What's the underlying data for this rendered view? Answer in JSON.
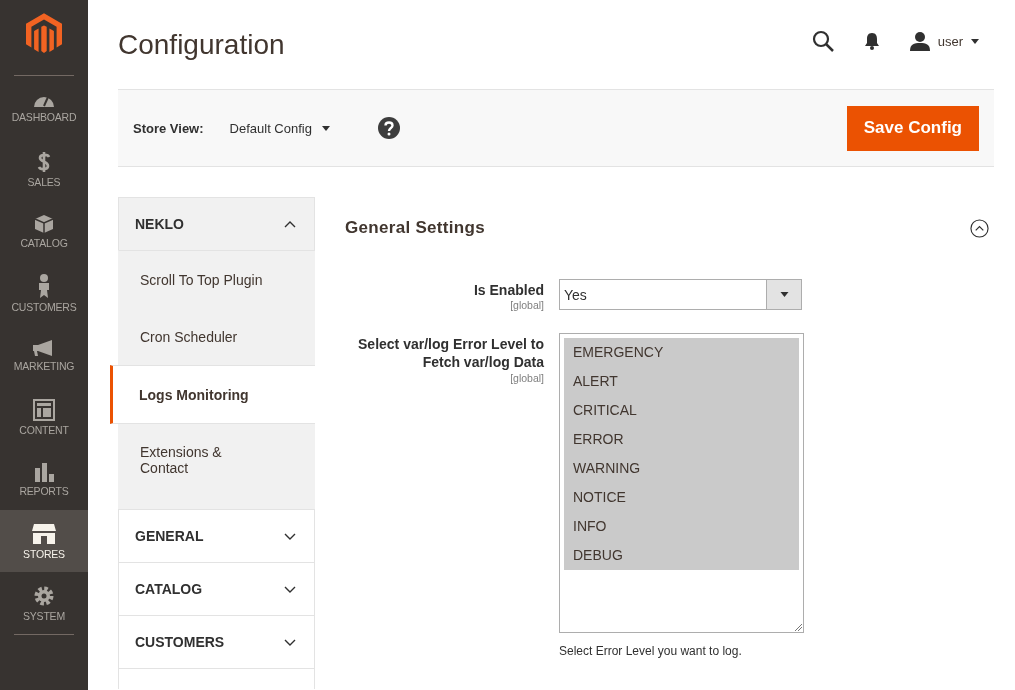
{
  "sidebar": {
    "items": [
      {
        "label": "DASHBOARD",
        "selected": false
      },
      {
        "label": "SALES",
        "selected": false
      },
      {
        "label": "CATALOG",
        "selected": false
      },
      {
        "label": "CUSTOMERS",
        "selected": false
      },
      {
        "label": "MARKETING",
        "selected": false
      },
      {
        "label": "CONTENT",
        "selected": false
      },
      {
        "label": "REPORTS",
        "selected": false
      },
      {
        "label": "STORES",
        "selected": true
      },
      {
        "label": "SYSTEM",
        "selected": false
      }
    ]
  },
  "header": {
    "title": "Configuration",
    "user": "user"
  },
  "store_bar": {
    "label": "Store View:",
    "value": "Default Config",
    "button": "Save Config"
  },
  "nav": [
    {
      "title": "NEKLO",
      "expanded": true,
      "children": [
        {
          "label": "Scroll To Top Plugin",
          "selected": false
        },
        {
          "label": "Cron Scheduler",
          "selected": false
        },
        {
          "label": "Logs Monitoring",
          "selected": true
        },
        {
          "label": "Extensions & Contact",
          "selected": false
        }
      ]
    },
    {
      "title": "GENERAL",
      "expanded": false
    },
    {
      "title": "CATALOG",
      "expanded": false
    },
    {
      "title": "CUSTOMERS",
      "expanded": false
    }
  ],
  "section": {
    "title": "General Settings",
    "expanded": true,
    "fields": [
      {
        "kind": "select",
        "label": "Is Enabled",
        "scope": "[global]",
        "value": "Yes"
      },
      {
        "kind": "multiselect",
        "label": "Select var/log Error Level to Fetch var/log Data",
        "scope": "[global]",
        "note": "Select Error Level you want to log.",
        "options": [
          {
            "label": "EMERGENCY",
            "selected": true
          },
          {
            "label": "ALERT",
            "selected": true
          },
          {
            "label": "CRITICAL",
            "selected": true
          },
          {
            "label": "ERROR",
            "selected": true
          },
          {
            "label": "WARNING",
            "selected": true
          },
          {
            "label": "NOTICE",
            "selected": true
          },
          {
            "label": "INFO",
            "selected": true
          },
          {
            "label": "DEBUG",
            "selected": true
          }
        ]
      }
    ]
  }
}
